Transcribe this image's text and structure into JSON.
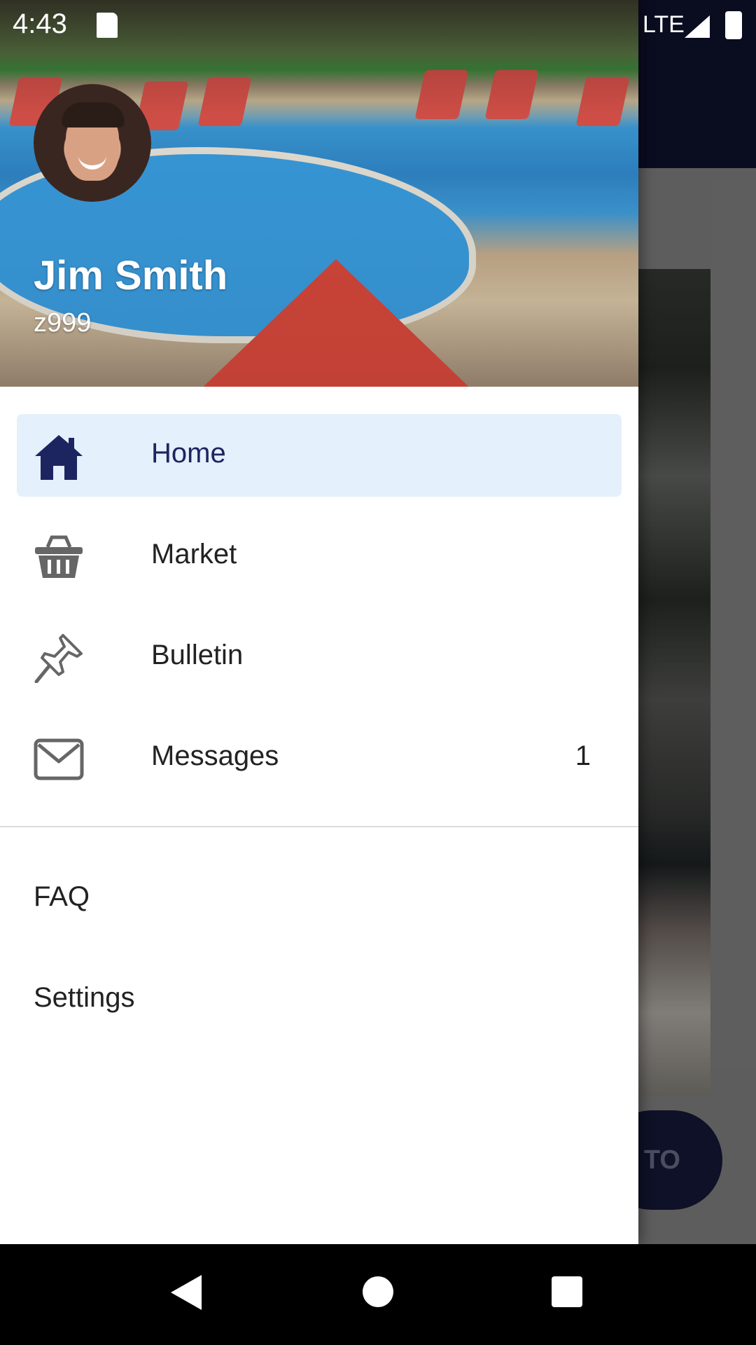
{
  "status_bar": {
    "time": "4:43",
    "network": "LTE"
  },
  "background_app": {
    "fab_label": "TO"
  },
  "drawer": {
    "user": {
      "name": "Jim Smith",
      "id": "z999"
    },
    "menu": [
      {
        "label": "Home",
        "icon": "home-icon",
        "active": true
      },
      {
        "label": "Market",
        "icon": "basket-icon"
      },
      {
        "label": "Bulletin",
        "icon": "pushpin-icon"
      },
      {
        "label": "Messages",
        "icon": "envelope-icon",
        "badge": "1"
      }
    ],
    "secondary": [
      {
        "label": "FAQ"
      },
      {
        "label": "Settings"
      }
    ]
  },
  "colors": {
    "accent": "#1d2560",
    "active_bg": "#e4f0fb",
    "toolbar": "#0f1230"
  }
}
